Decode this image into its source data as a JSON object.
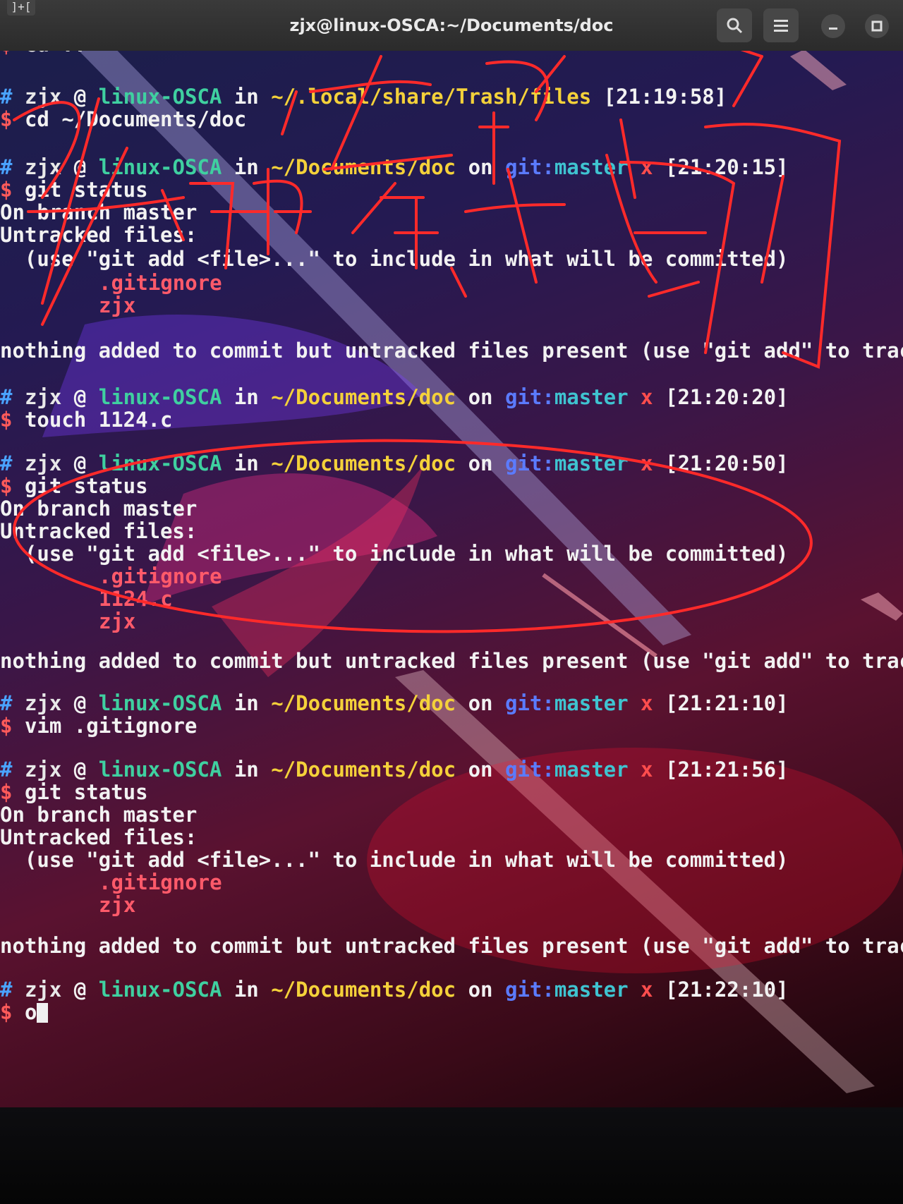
{
  "window": {
    "title": "zjx@linux-OSCA:~/Documents/doc",
    "new_tab_icon": "new-tab-icon",
    "search_icon": "search-icon",
    "menu_icon": "hamburger-menu-icon",
    "minimize_icon": "minimize-icon",
    "maximize_icon": "maximize-icon"
  },
  "prompt": {
    "hash": "#",
    "user": "zjx",
    "at": "@",
    "host": "linux-OSCA",
    "in": "in",
    "path_doc": "~/Documents/doc",
    "path_trash": "~/.local/share/Trash/files",
    "on": "on",
    "git": "git:",
    "branch": "master",
    "dirty": "x",
    "dollar": "$"
  },
  "blocks": {
    "b0_cmd": "cd ..",
    "b1_time": "[21:19:58]",
    "b1_cmd": "cd ~/Documents/doc",
    "b2_time": "[21:20:15]",
    "b2_cmd": "git status",
    "b3_time": "[21:20:20]",
    "b3_cmd": "touch 1124.c",
    "b4_time": "[21:20:50]",
    "b4_cmd": "git status",
    "b5_time": "[21:21:10]",
    "b5_cmd": "vim .gitignore",
    "b6_time": "[21:21:56]",
    "b6_cmd": "git status",
    "b7_time": "[21:22:10]",
    "b7_cmd": "o"
  },
  "output": {
    "on_branch": "On branch master",
    "untracked": "Untracked files:",
    "use_hint": "  (use \"git add <file>...\" to include in what will be committed)",
    "file_gitignore": ".gitignore",
    "file_zjx": "zjx",
    "file_1124": "1124.c",
    "nothing_added": "nothing added to commit but untracked files present (use \"git add\" to track)"
  },
  "colors": {
    "annotation": "#ff2a2a",
    "path": "#f4d13a",
    "host": "#3fd0a0",
    "untracked_file": "#ff5a6a"
  }
}
